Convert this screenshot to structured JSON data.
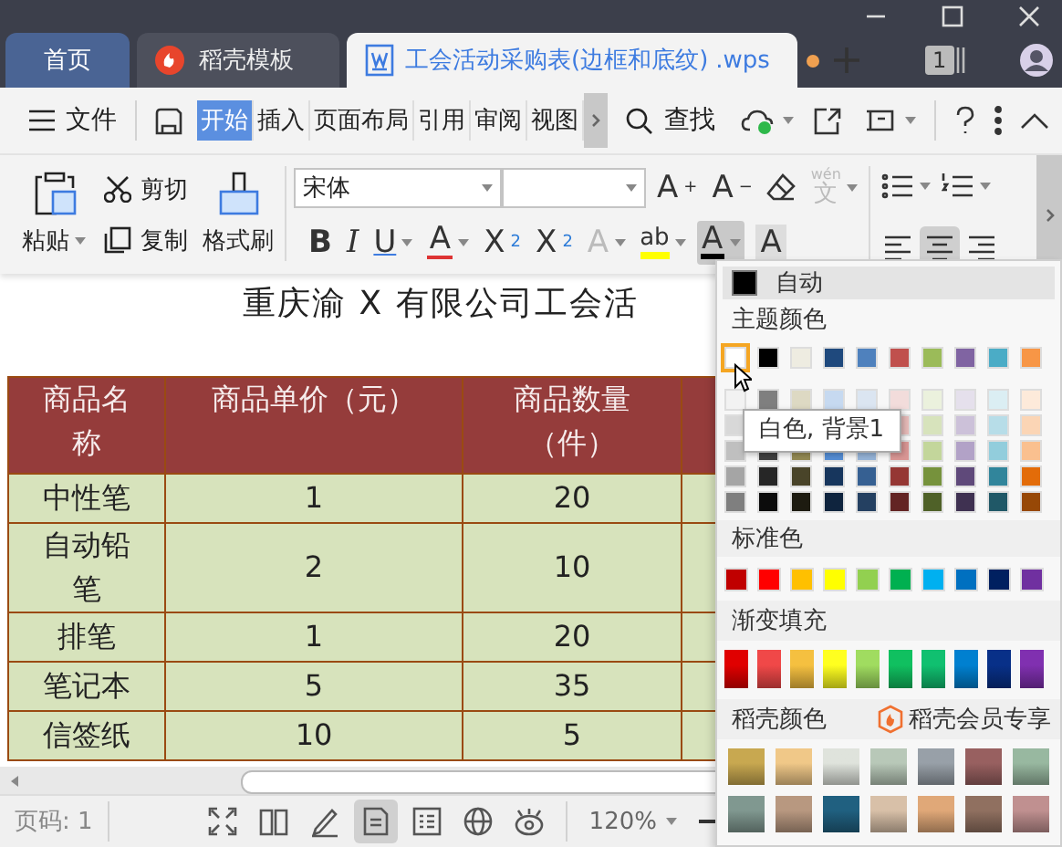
{
  "tabs": [
    {
      "kind": "home",
      "label": "首页",
      "selected": false
    },
    {
      "kind": "template",
      "label": "稻壳模板",
      "selected": false
    },
    {
      "kind": "document",
      "label": "工会活动采购表(边框和底纹)",
      "suffix": ".wps",
      "selected": true,
      "modified": true
    }
  ],
  "window_count": "1",
  "menu": {
    "file": "文件",
    "tabs": [
      {
        "label": "开始",
        "selected": true
      },
      {
        "label": "插入",
        "selected": false
      },
      {
        "label": "页面布局",
        "selected": false
      },
      {
        "label": "引用",
        "selected": false
      },
      {
        "label": "审阅",
        "selected": false
      },
      {
        "label": "视图",
        "selected": false
      }
    ],
    "search": "查找"
  },
  "ribbon": {
    "paste": "粘贴",
    "cut": "剪切",
    "copy": "复制",
    "format_painter": "格式刷",
    "font_name": "宋体",
    "grow_font": {
      "letter": "A",
      "sign": "+"
    },
    "shrink_font": {
      "letter": "A",
      "sign": "−"
    },
    "phonetic": {
      "top": "wén",
      "glyph": "文",
      "disabled": true
    },
    "bold": "B",
    "italic": "I",
    "underline": "U",
    "strikethrough": "A",
    "superscript": {
      "letter": "X",
      "sign": "2"
    },
    "subscript": {
      "letter": "X",
      "sign": "2"
    },
    "text_effect": {
      "letter": "A",
      "disabled": true
    },
    "highlight": "ab",
    "font_color": {
      "letter": "A",
      "pressed": true
    },
    "char_shading": "A",
    "align": [
      {
        "selected": false
      },
      {
        "selected": true
      },
      {
        "selected": false
      }
    ]
  },
  "document": {
    "title": "重庆渝 X 有限公司工会活",
    "table": {
      "columns": [
        "商品名称",
        "商品单价（元）",
        "商品数量（件）"
      ],
      "rows": [
        [
          "中性笔",
          "1",
          "20"
        ],
        [
          "自动铅笔",
          "2",
          "10"
        ],
        [
          "排笔",
          "1",
          "20"
        ],
        [
          "笔记本",
          "5",
          "35"
        ],
        [
          "信签纸",
          "10",
          "5"
        ]
      ]
    }
  },
  "status_bar": {
    "page": "页码: 1",
    "zoom": "120%",
    "view_modes": [
      {
        "selected": false
      },
      {
        "selected": false
      },
      {
        "selected": false
      },
      {
        "selected": true
      },
      {
        "selected": false
      },
      {
        "selected": false
      },
      {
        "selected": false
      }
    ]
  },
  "color_menu": {
    "automatic": {
      "label": "自动",
      "color": "#000000"
    },
    "theme_label": "主题颜色",
    "theme_colors": [
      {
        "color": "#ffffff",
        "selected": true
      },
      {
        "color": "#000000",
        "selected": false
      },
      {
        "color": "#eeece1",
        "selected": false
      },
      {
        "color": "#1f497d",
        "selected": false
      },
      {
        "color": "#4f81bd",
        "selected": false
      },
      {
        "color": "#c0504d",
        "selected": false
      },
      {
        "color": "#9bbb59",
        "selected": false
      },
      {
        "color": "#8064a2",
        "selected": false
      },
      {
        "color": "#4bacc6",
        "selected": false
      },
      {
        "color": "#f79646",
        "selected": false
      }
    ],
    "tints": [
      [
        {
          "color": "#f2f2f2"
        },
        {
          "color": "#7f7f7f"
        },
        {
          "color": "#ddd9c3"
        },
        {
          "color": "#c6d9f0"
        },
        {
          "color": "#dbe5f1"
        },
        {
          "color": "#f2dcdb"
        },
        {
          "color": "#ebf1dd"
        },
        {
          "color": "#e5e0ec"
        },
        {
          "color": "#dbeef3"
        },
        {
          "color": "#fdeada"
        }
      ],
      [
        {
          "color": "#d8d8d8"
        },
        {
          "color": "#e5b9b7"
        },
        {
          "color": "#d7e3bc"
        },
        {
          "color": "#ccc1d9"
        },
        {
          "color": "#b7dde8"
        },
        {
          "color": "#fbd5b5"
        }
      ],
      [
        {
          "color": "#bfbfbf"
        },
        {
          "color": "#3f3f3f"
        },
        {
          "color": "#938953"
        },
        {
          "color": "#548dd4"
        },
        {
          "color": "#95b3d7"
        },
        {
          "color": "#d99694"
        },
        {
          "color": "#c3d69b"
        },
        {
          "color": "#b2a2c7"
        },
        {
          "color": "#92cddc"
        },
        {
          "color": "#fac08f"
        }
      ],
      [
        {
          "color": "#a5a5a5"
        },
        {
          "color": "#262626"
        },
        {
          "color": "#494429"
        },
        {
          "color": "#17365d"
        },
        {
          "color": "#366092"
        },
        {
          "color": "#953734"
        },
        {
          "color": "#76923c"
        },
        {
          "color": "#5f497a"
        },
        {
          "color": "#31859b"
        },
        {
          "color": "#e36c09"
        }
      ],
      [
        {
          "color": "#7f7f7f"
        },
        {
          "color": "#0c0c0c"
        },
        {
          "color": "#1d1b10"
        },
        {
          "color": "#0f243e"
        },
        {
          "color": "#244061"
        },
        {
          "color": "#632423"
        },
        {
          "color": "#4f6128"
        },
        {
          "color": "#3f3151"
        },
        {
          "color": "#205867"
        },
        {
          "color": "#974806"
        }
      ]
    ],
    "tooltip": "白色, 背景1",
    "standard_label": "标准色",
    "standard_colors": [
      {
        "color": "#c00000"
      },
      {
        "color": "#ff0000"
      },
      {
        "color": "#ffc000"
      },
      {
        "color": "#ffff00"
      },
      {
        "color": "#92d050"
      },
      {
        "color": "#00b050"
      },
      {
        "color": "#00b0f0"
      },
      {
        "color": "#0070c0"
      },
      {
        "color": "#002060"
      },
      {
        "color": "#7030a0"
      }
    ],
    "gradient_label": "渐变填充",
    "gradients": [
      {
        "color": "#e00000"
      },
      {
        "color": "#f04848"
      },
      {
        "color": "#f5c040"
      },
      {
        "color": "#ffff20"
      },
      {
        "color": "#a0dc60"
      },
      {
        "color": "#10c060"
      },
      {
        "color": "#10c070"
      },
      {
        "color": "#0080d0"
      },
      {
        "color": "#083088"
      },
      {
        "color": "#8030b0"
      }
    ],
    "docer_label": "稻壳颜色",
    "member_label": "稻壳会员专享",
    "docer_colors": [
      [
        {
          "color": "#c8a850"
        },
        {
          "color": "#f0c888"
        },
        {
          "color": "#dfe3dc"
        },
        {
          "color": "#b8c8b8"
        },
        {
          "color": "#98a0a8"
        },
        {
          "color": "#986060"
        },
        {
          "color": "#98b8a0"
        }
      ],
      [
        {
          "color": "#809890"
        },
        {
          "color": "#b89880"
        },
        {
          "color": "#206080"
        },
        {
          "color": "#d8c0a8"
        },
        {
          "color": "#e0a878"
        },
        {
          "color": "#907060"
        },
        {
          "color": "#c09090"
        }
      ]
    ]
  }
}
